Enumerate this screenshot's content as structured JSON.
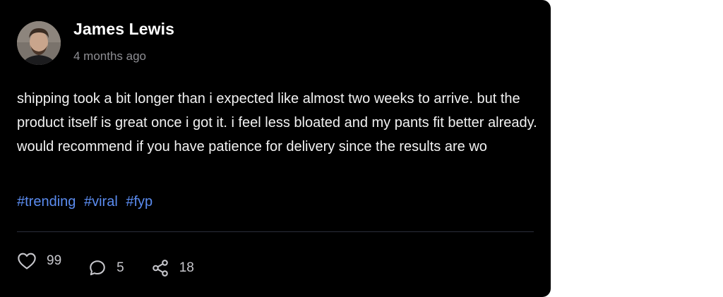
{
  "post": {
    "author": {
      "name": "James Lewis",
      "avatar_icon": "user-avatar-photo"
    },
    "timestamp": "4 months ago",
    "body": "shipping took a bit longer than i expected like almost two weeks to arrive. but the product itself is great once i got it. i feel less bloated and my pants fit better already. would recommend if you have patience for delivery since the results are wo",
    "hashtags": [
      "#trending",
      "#viral",
      "#fyp"
    ],
    "stats": {
      "likes": "99",
      "comments": "5",
      "shares": "18"
    },
    "icons": {
      "like": "heart-icon",
      "comment": "comment-bubble-icon",
      "share": "share-icon"
    }
  },
  "colors": {
    "card_background": "#000000",
    "hashtag": "#5b8cf0",
    "divider": "#2a2d3a",
    "muted_text": "#8e8e93"
  }
}
